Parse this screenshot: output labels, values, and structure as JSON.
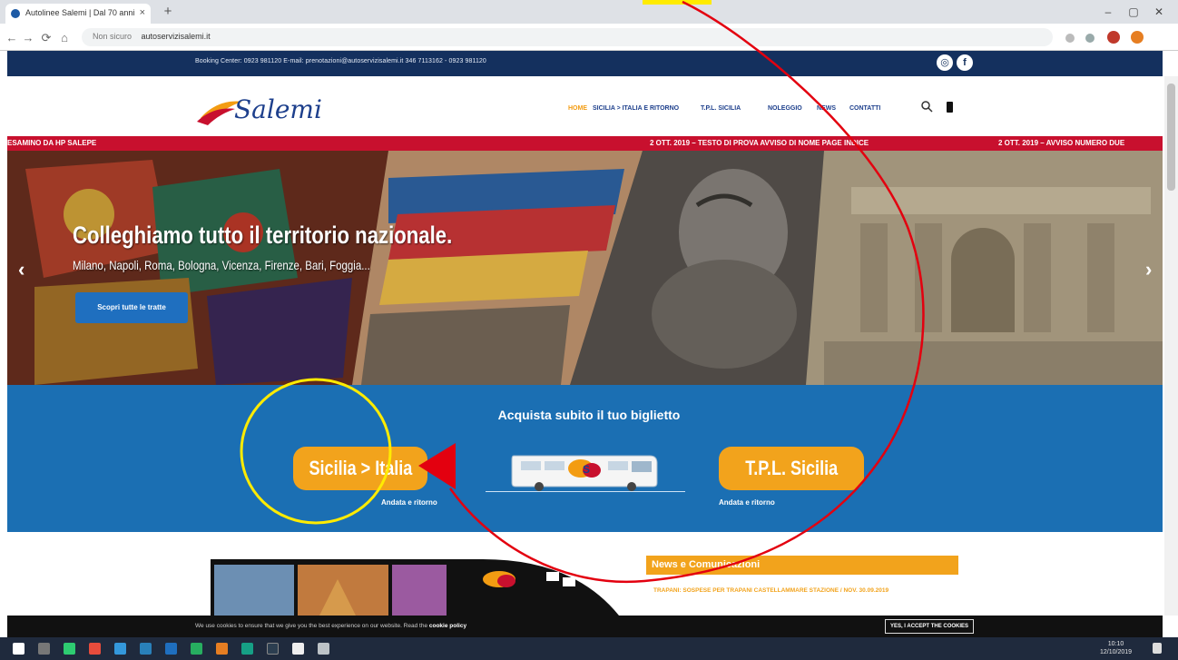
{
  "browser": {
    "tab_title": "Autolinee Salemi | Dal 70 anni",
    "tab_close": "×",
    "new_tab": "+",
    "url_secure_label": "Non sicuro",
    "url": "autoservizisalemi.it",
    "window_controls": [
      "–",
      "▢",
      "✕"
    ],
    "nav_buttons": [
      "←",
      "→",
      "⟳",
      "⌂"
    ]
  },
  "site": {
    "topbar_text": "Booking Center: 0923 981120 E-mail: prenotazioni@autoservizisalemi.it 346 7113162 - 0923 981120",
    "logo_text": "Salemi",
    "nav": [
      {
        "label": "HOME",
        "active": true
      },
      {
        "label": "SICILIA > ITALIA E RITORNO",
        "active": false
      },
      {
        "label": "T.P.L. SICILIA",
        "active": false
      },
      {
        "label": "NOLEGGIO",
        "active": false
      },
      {
        "label": "NEWS",
        "active": false
      },
      {
        "label": "CONTATTI",
        "active": false
      }
    ],
    "ticker": [
      "ESAMINO DA HP SALEPE",
      "2 OTT. 2019 – TESTO DI PROVA AVVISO DI NOME PAGE INDICE",
      "2 OTT. 2019 – AVVISO NUMERO DUE"
    ],
    "hero": {
      "title": "Colleghiamo tutto il territorio nazionale.",
      "subtitle": "Milano, Napoli, Roma, Bologna, Vicenza, Firenze, Bari, Foggia...",
      "button_label": "Scopri tutte le tratte",
      "prev_arrow": "‹",
      "next_arrow": "›"
    },
    "booking": {
      "title": "Acquista subito il tuo biglietto",
      "options": [
        {
          "label": "Sicilia > Italia",
          "sub": "Andata e ritorno"
        },
        {
          "label": "T.P.L. Sicilia",
          "sub": "Andata e ritorno"
        }
      ]
    },
    "news": {
      "header": "News e Comunicazioni",
      "item": "TRAPANI: SOSPESE PER TRAPANI CASTELLAMMARE STAZIONE / NOV. 30.09.2019"
    },
    "cookie": {
      "text": "We use cookies to ensure that we give you the best experience on our website. Read the",
      "link": "cookie policy",
      "button": "YES, I ACCEPT THE COOKIES"
    }
  },
  "taskbar": {
    "time": "10:10",
    "date": "12/10/2019"
  },
  "colors": {
    "topbar": "#14305e",
    "ticker": "#c8102e",
    "booking_bg": "#1b6fb3",
    "accent_orange": "#f2a31c",
    "annotation_red": "#e3000f",
    "annotation_yellow": "#ffeb00"
  }
}
